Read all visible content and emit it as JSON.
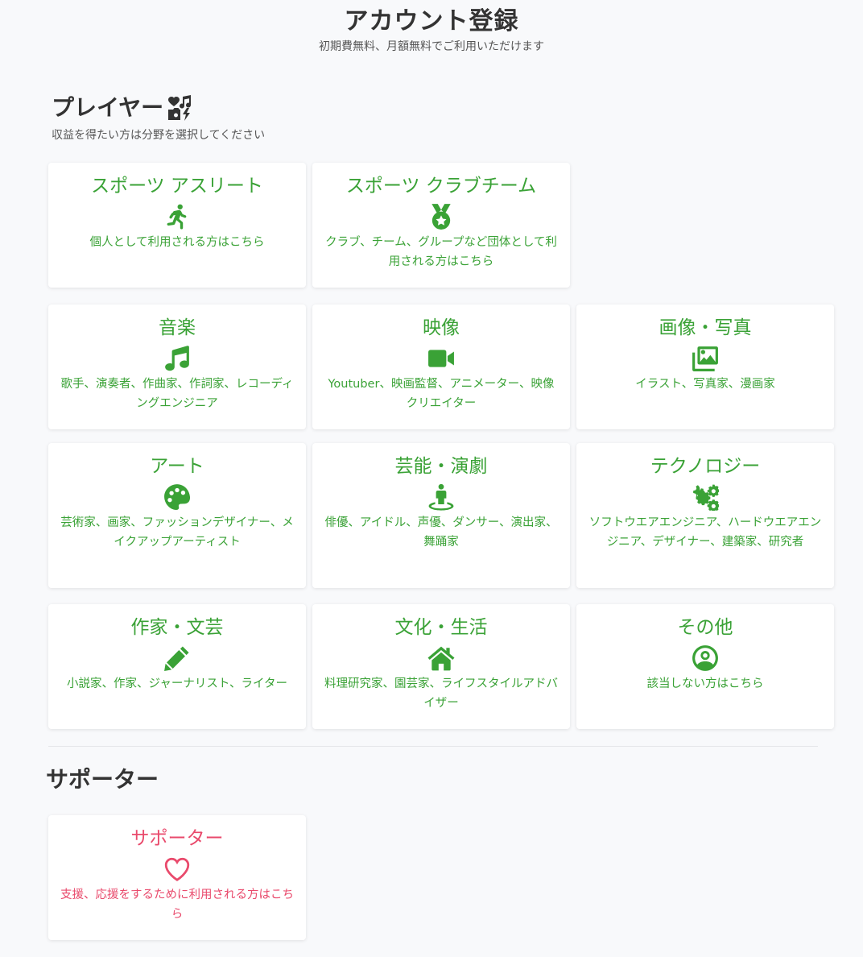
{
  "header": {
    "title": "アカウント登録",
    "subtitle": "初期費無料、月額無料でご利用いただけます"
  },
  "player_section": {
    "title": "プレイヤー",
    "title_icon": "icons-icon",
    "description": "収益を得たい方は分野を選択してください",
    "cards": [
      {
        "title": "スポーツ アスリート",
        "icon": "running-icon",
        "description": "個人として利用される方はこちら"
      },
      {
        "title": "スポーツ クラブチーム",
        "icon": "medal-icon",
        "description": "クラブ、チーム、グループなど団体として利用される方はこちら"
      },
      {
        "title": "音楽",
        "icon": "music-icon",
        "description": "歌手、演奏者、作曲家、作詞家、レコーディングエンジニア"
      },
      {
        "title": "映像",
        "icon": "video-icon",
        "description": "Youtuber、映画監督、アニメーター、映像クリエイター"
      },
      {
        "title": "画像・写真",
        "icon": "images-icon",
        "description": "イラスト、写真家、漫画家"
      },
      {
        "title": "アート",
        "icon": "palette-icon",
        "description": "芸術家、画家、ファッションデザイナー、メイクアップアーティスト"
      },
      {
        "title": "芸能・演劇",
        "icon": "street-view-icon",
        "description": "俳優、アイドル、声優、ダンサー、演出家、舞踊家"
      },
      {
        "title": "テクノロジー",
        "icon": "cogs-icon",
        "description": "ソフトウエアエンジニア、ハードウエアエンジニア、デザイナー、建築家、研究者"
      },
      {
        "title": "作家・文芸",
        "icon": "pencil-icon",
        "description": "小説家、作家、ジャーナリスト、ライター"
      },
      {
        "title": "文化・生活",
        "icon": "home-icon",
        "description": "料理研究家、園芸家、ライフスタイルアドバイザー"
      },
      {
        "title": "その他",
        "icon": "user-circle-icon",
        "description": "該当しない方はこちら"
      }
    ]
  },
  "supporter_section": {
    "title": "サポーター",
    "cards": [
      {
        "title": "サポーター",
        "icon": "heart-icon",
        "description": "支援、応援をするために利用される方はこちら"
      }
    ]
  },
  "colors": {
    "player_accent": "#3aa236",
    "supporter_accent": "#e94a6c",
    "background": "#f8f9fb"
  }
}
